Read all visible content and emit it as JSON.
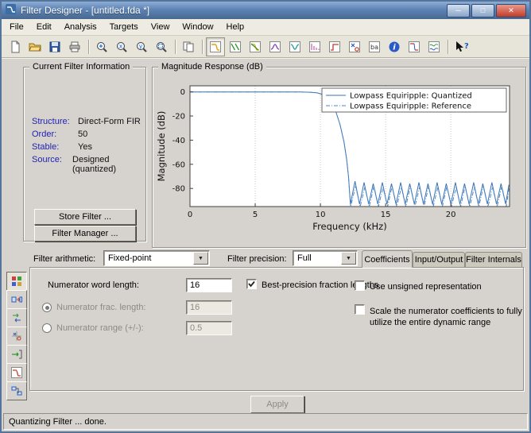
{
  "window": {
    "title": "Filter Designer -  [untitled.fda *]",
    "controls": {
      "minimize": "─",
      "maximize": "□",
      "close": "✕"
    }
  },
  "menu": {
    "items": [
      "File",
      "Edit",
      "Analysis",
      "Targets",
      "View",
      "Window",
      "Help"
    ]
  },
  "toolbar": {
    "icons": [
      "new-session",
      "open-session",
      "save-session",
      "print",
      "zoom-in",
      "zoom-x",
      "zoom-y",
      "restore-default-view",
      "duplicate-analysis",
      "magnitude-response",
      "phase-response",
      "magnitude-and-phase",
      "group-delay",
      "phase-delay",
      "impulse-response",
      "step-response",
      "pole-zero-plot",
      "filter-coefficients",
      "filter-information",
      "magnitude-specs",
      "overlay-analysis",
      "whats-this-help"
    ],
    "selected_icon": "magnitude-response"
  },
  "filter_info": {
    "legend": "Current Filter Information",
    "rows": [
      {
        "label": "Structure:",
        "value": "Direct-Form FIR"
      },
      {
        "label": "Order:",
        "value": "50"
      },
      {
        "label": "Stable:",
        "value": "Yes"
      },
      {
        "label": "Source:",
        "value": "Designed (quantized)"
      }
    ],
    "store_button": "Store Filter ...",
    "manager_button": "Filter Manager ..."
  },
  "magnitude_panel": {
    "legend": "Magnitude Response (dB)"
  },
  "chart_data": {
    "type": "line",
    "title": "Magnitude Response (dB)",
    "xlabel": "Frequency (kHz)",
    "ylabel": "Magnitude (dB)",
    "xlim": [
      0,
      24.5
    ],
    "ylim": [
      -95,
      5
    ],
    "xticks": [
      0,
      5,
      10,
      15,
      20
    ],
    "yticks": [
      0,
      -20,
      -40,
      -60,
      -80
    ],
    "grid": "vertical-dotted",
    "legend_position": "top-right",
    "series": [
      {
        "name": "Lowpass Equiripple: Quantized",
        "style": "solid",
        "color": "#3a73b5",
        "points": [
          [
            0,
            -0.05
          ],
          [
            1.5,
            -0.05
          ],
          [
            3,
            -0.05
          ],
          [
            4.5,
            -0.05
          ],
          [
            6,
            -0.05
          ],
          [
            7.5,
            -0.05
          ],
          [
            8.5,
            -0.1
          ],
          [
            9.2,
            -0.3
          ],
          [
            9.7,
            -0.8
          ],
          [
            10,
            -1.6
          ],
          [
            10.3,
            -3.2
          ],
          [
            10.6,
            -6
          ],
          [
            10.9,
            -10.5
          ],
          [
            11.2,
            -17
          ],
          [
            11.5,
            -27
          ],
          [
            11.8,
            -41
          ],
          [
            12,
            -55
          ],
          [
            12.15,
            -70
          ],
          [
            12.3,
            -93
          ],
          [
            12.65,
            -74
          ],
          [
            13,
            -93
          ],
          [
            13.35,
            -75
          ],
          [
            13.7,
            -93
          ],
          [
            14.05,
            -76
          ],
          [
            14.4,
            -93
          ],
          [
            14.75,
            -75
          ],
          [
            15.1,
            -93
          ],
          [
            15.45,
            -76
          ],
          [
            15.8,
            -93
          ],
          [
            16.15,
            -75
          ],
          [
            16.5,
            -93
          ],
          [
            16.85,
            -76
          ],
          [
            17.2,
            -93
          ],
          [
            17.55,
            -75
          ],
          [
            17.9,
            -93
          ],
          [
            18.25,
            -76
          ],
          [
            18.6,
            -93
          ],
          [
            18.95,
            -75
          ],
          [
            19.3,
            -93
          ],
          [
            19.65,
            -76
          ],
          [
            20,
            -93
          ],
          [
            20.35,
            -75
          ],
          [
            20.7,
            -93
          ],
          [
            21.05,
            -76
          ],
          [
            21.4,
            -93
          ],
          [
            21.75,
            -75
          ],
          [
            22.1,
            -93
          ],
          [
            22.45,
            -76
          ],
          [
            22.8,
            -93
          ],
          [
            23.15,
            -75
          ],
          [
            23.5,
            -93
          ],
          [
            23.85,
            -76
          ],
          [
            24.2,
            -93
          ],
          [
            24.45,
            -77
          ]
        ]
      },
      {
        "name": "Lowpass Equiripple: Reference",
        "style": "dash-dot",
        "color": "#4a85c5",
        "points": [
          [
            0,
            -0.05
          ],
          [
            1.5,
            -0.05
          ],
          [
            3,
            -0.05
          ],
          [
            4.5,
            -0.05
          ],
          [
            6,
            -0.05
          ],
          [
            7.5,
            -0.05
          ],
          [
            8.5,
            -0.1
          ],
          [
            9.2,
            -0.3
          ],
          [
            9.7,
            -0.8
          ],
          [
            10,
            -1.6
          ],
          [
            10.3,
            -3.2
          ],
          [
            10.6,
            -6
          ],
          [
            10.9,
            -10.5
          ],
          [
            11.2,
            -17
          ],
          [
            11.5,
            -27
          ],
          [
            11.8,
            -41
          ],
          [
            12,
            -55
          ],
          [
            12.15,
            -70
          ],
          [
            12.32,
            -95
          ],
          [
            12.7,
            -78
          ],
          [
            13.05,
            -95
          ],
          [
            13.4,
            -79
          ],
          [
            13.75,
            -95
          ],
          [
            14.1,
            -78
          ],
          [
            14.45,
            -95
          ],
          [
            14.8,
            -79
          ],
          [
            15.15,
            -95
          ],
          [
            15.5,
            -78
          ],
          [
            15.85,
            -95
          ],
          [
            16.2,
            -79
          ],
          [
            16.55,
            -95
          ],
          [
            16.9,
            -78
          ],
          [
            17.25,
            -95
          ],
          [
            17.6,
            -79
          ],
          [
            17.95,
            -95
          ],
          [
            18.3,
            -78
          ],
          [
            18.65,
            -95
          ],
          [
            19,
            -79
          ],
          [
            19.35,
            -95
          ],
          [
            19.7,
            -78
          ],
          [
            20.05,
            -95
          ],
          [
            20.4,
            -79
          ],
          [
            20.75,
            -95
          ],
          [
            21.1,
            -78
          ],
          [
            21.45,
            -95
          ],
          [
            21.8,
            -79
          ],
          [
            22.15,
            -95
          ],
          [
            22.5,
            -78
          ],
          [
            22.85,
            -95
          ],
          [
            23.2,
            -79
          ],
          [
            23.55,
            -95
          ],
          [
            23.9,
            -78
          ],
          [
            24.25,
            -95
          ],
          [
            24.45,
            -80
          ]
        ]
      }
    ]
  },
  "sidebar": {
    "items": [
      "set-quantization-parameters",
      "transform-filter",
      "multirate-filter",
      "pole-zero-editor",
      "import-filter",
      "design-filter",
      "realize-model"
    ],
    "active_item": "set-quantization-parameters"
  },
  "quantization_panel": {
    "filter_arithmetic_label": "Filter arithmetic:",
    "filter_arithmetic_value": "Fixed-point",
    "filter_precision_label": "Filter precision:",
    "filter_precision_value": "Full",
    "tabs": [
      "Coefficients",
      "Input/Output",
      "Filter Internals"
    ],
    "active_tab": "Coefficients",
    "numerator_word_length_label": "Numerator word length:",
    "numerator_word_length_value": "16",
    "best_precision_label": "Best-precision fraction lengths",
    "numerator_frac_label": "Numerator frac. length:",
    "numerator_frac_value": "16",
    "numerator_range_label": "Numerator range (+/-):",
    "numerator_range_value": "0.5",
    "unsigned_label": "Use unsigned representation",
    "scale_label": "Scale the numerator coefficients to fully utilize the entire dynamic range",
    "apply_button": "Apply"
  },
  "status_bar": {
    "text": "Quantizing Filter ... done."
  }
}
